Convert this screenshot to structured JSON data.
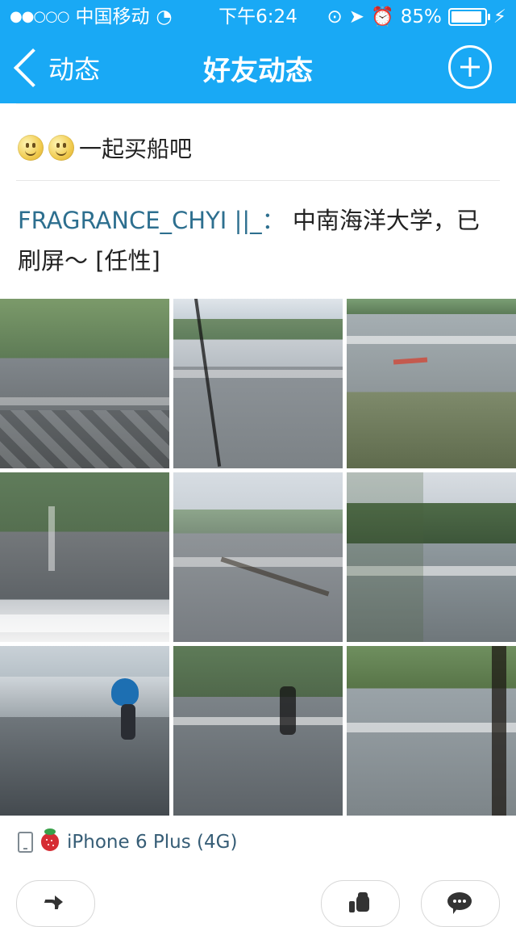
{
  "status_bar": {
    "signal_dots": "●●○○○",
    "carrier": "中国移动",
    "time": "下午6:24",
    "battery": "85%"
  },
  "nav": {
    "back_label": "动态",
    "title": "好友动态"
  },
  "post": {
    "comment": "一起买船吧",
    "username": "FRAGRANCE_CHYI",
    "username_suffix": "||_：",
    "body": "中南海洋大学，已刷屏～ [任性]"
  },
  "photos": [
    "flooded-campus-photo-1",
    "flooded-campus-photo-2",
    "flooded-campus-photo-3",
    "flooded-campus-photo-4",
    "flooded-campus-photo-5",
    "flooded-campus-photo-6",
    "flooded-campus-photo-7",
    "flooded-campus-photo-8",
    "flooded-campus-photo-9"
  ],
  "device": {
    "label": "iPhone 6 Plus (4G)"
  },
  "icons": {
    "back": "chevron-left-icon",
    "plus": "add-icon",
    "phone": "phone-icon",
    "strawberry": "strawberry-icon",
    "share": "share-icon",
    "like": "like-icon",
    "comment": "comment-icon"
  },
  "colors": {
    "header_bg": "#19a9f5",
    "header_text": "#ffffff",
    "username": "#2d6f8f",
    "device_text": "#365d76"
  }
}
